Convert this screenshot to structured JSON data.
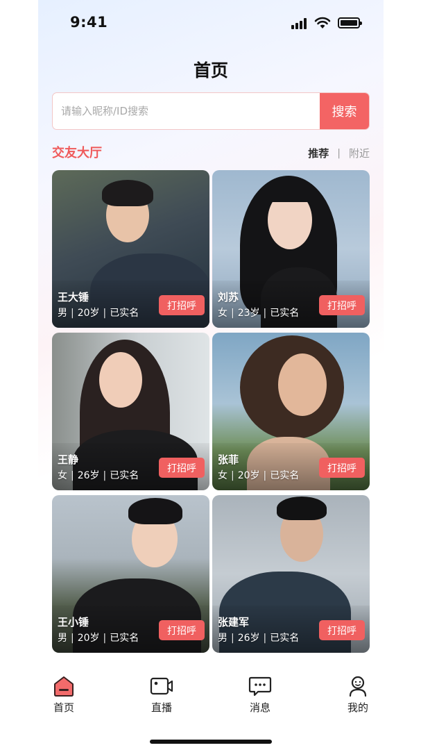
{
  "status_bar": {
    "time": "9:41"
  },
  "page": {
    "title": "首页"
  },
  "search": {
    "placeholder": "请输入昵称/ID搜索",
    "value": "",
    "button_label": "搜索"
  },
  "section": {
    "title": "交友大厅",
    "filters": {
      "active": "推荐",
      "separator": "|",
      "inactive": "附近"
    }
  },
  "cards": [
    {
      "name": "王大锤",
      "gender": "男",
      "age": "20岁",
      "verified": "已实名",
      "button": "打招呼"
    },
    {
      "name": "刘苏",
      "gender": "女",
      "age": "23岁",
      "verified": "已实名",
      "button": "打招呼"
    },
    {
      "name": "王静",
      "gender": "女",
      "age": "26岁",
      "verified": "已实名",
      "button": "打招呼"
    },
    {
      "name": "张菲",
      "gender": "女",
      "age": "20岁",
      "verified": "已实名",
      "button": "打招呼"
    },
    {
      "name": "王小锤",
      "gender": "男",
      "age": "20岁",
      "verified": "已实名",
      "button": "打招呼"
    },
    {
      "name": "张建军",
      "gender": "男",
      "age": "26岁",
      "verified": "已实名",
      "button": "打招呼"
    }
  ],
  "meta_separator": "|",
  "tab_bar": [
    {
      "label": "首页",
      "icon": "home-icon"
    },
    {
      "label": "直播",
      "icon": "video-camera-icon"
    },
    {
      "label": "消息",
      "icon": "chat-bubble-icon"
    },
    {
      "label": "我的",
      "icon": "person-icon"
    }
  ],
  "colors": {
    "accent": "#f36464",
    "section_title": "#ef5a5a"
  }
}
